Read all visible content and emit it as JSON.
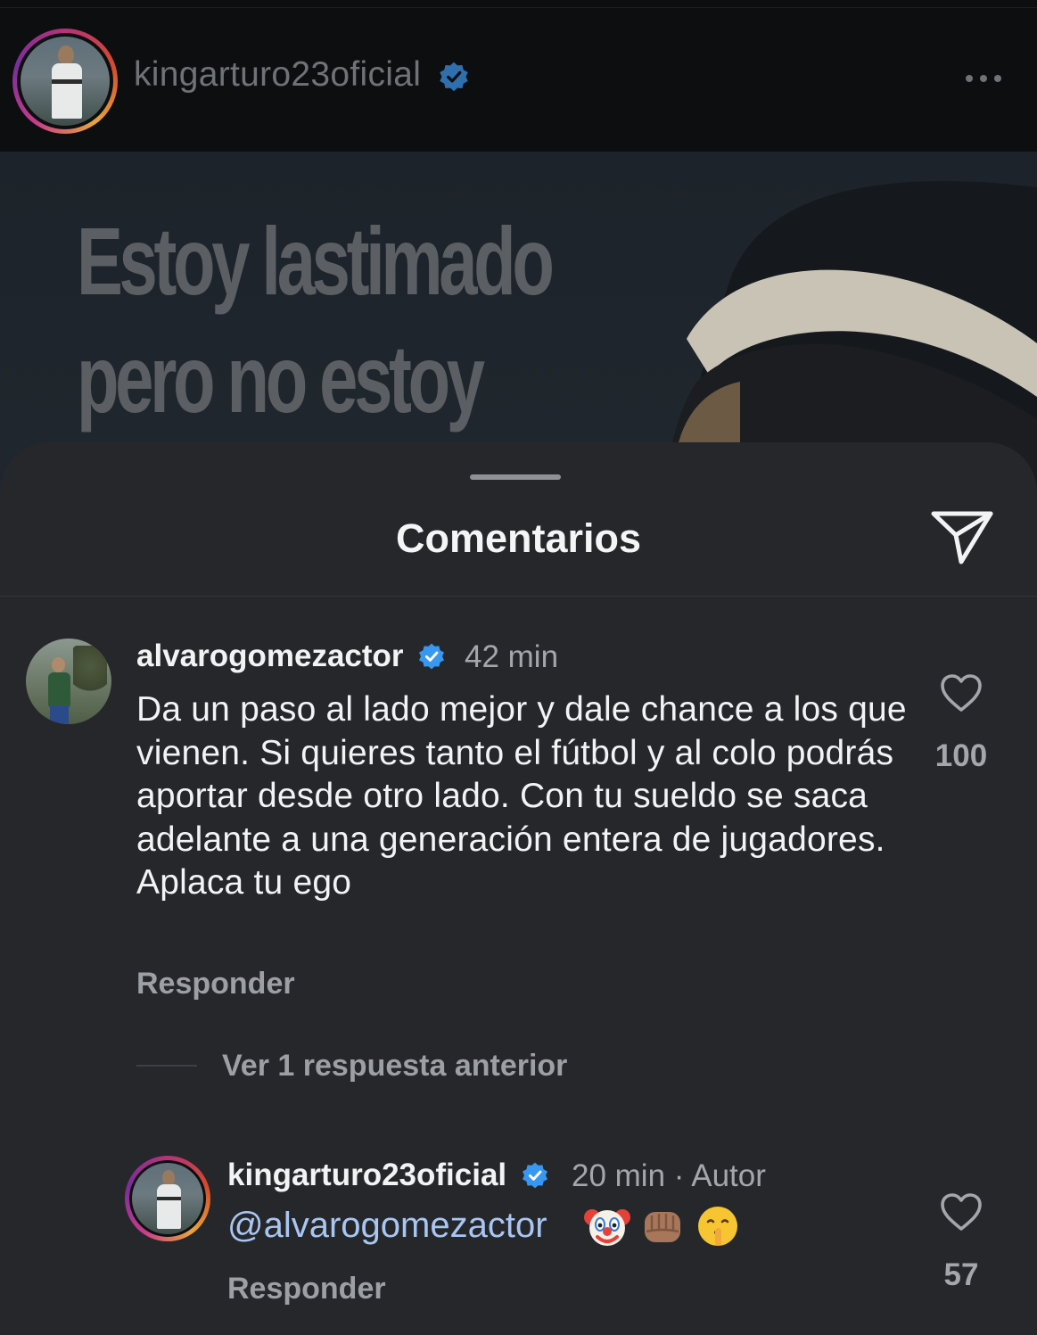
{
  "post": {
    "username": "kingarturo23oficial",
    "image_text_line1": "Estoy lastimado",
    "image_text_line2": "pero no estoy"
  },
  "sheet": {
    "title": "Comentarios"
  },
  "comments": [
    {
      "username": "alvarogomezactor",
      "verified": true,
      "time": "42 min",
      "text": "Da un paso al lado mejor y dale chance a los que vienen. Si quieres tanto el fútbol y al colo podrás aportar desde otro lado. Con tu sueldo se saca adelante a una generación entera de jugadores. Aplaca tu ego",
      "reply_label": "Responder",
      "likes": "100",
      "view_replies_label": "Ver 1 respuesta anterior"
    }
  ],
  "reply": {
    "username": "kingarturo23oficial",
    "verified": true,
    "time": "20 min · Autor",
    "mention": "@alvarogomezactor",
    "emojis": [
      "clown-face",
      "fist-bump",
      "shushing-face"
    ],
    "reply_label": "Responder",
    "likes": "57"
  },
  "icons": {
    "verified": "verified-badge-icon",
    "like": "heart-icon",
    "share": "paper-plane-icon",
    "more": "more-dots-icon"
  },
  "colors": {
    "sheet_bg": "#25272b",
    "verified_blue": "#3897f0",
    "mention_blue": "#a9c6f2"
  }
}
